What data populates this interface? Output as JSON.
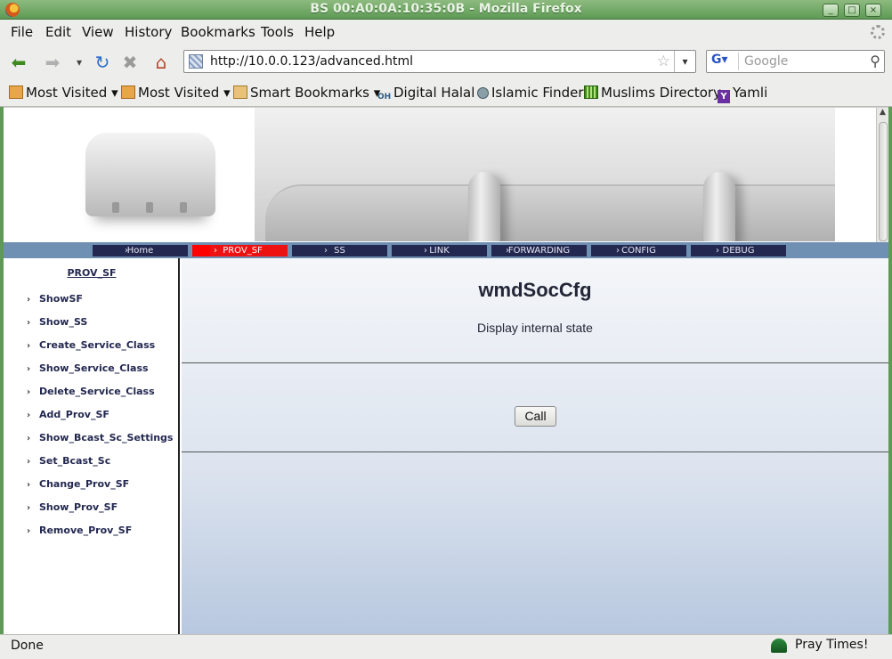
{
  "window": {
    "title": "BS 00:A0:0A:10:35:0B - Mozilla Firefox"
  },
  "menu": [
    "File",
    "Edit",
    "View",
    "History",
    "Bookmarks",
    "Tools",
    "Help"
  ],
  "nav": {
    "url": "http://10.0.0.123/advanced.html",
    "search_placeholder": "Google"
  },
  "bookmarks": [
    "Most Visited",
    "Most Visited",
    "Smart Bookmarks",
    "Digital Halal",
    "Islamic Finder",
    "Muslims Directory",
    "Yamli"
  ],
  "topnav": [
    "Home",
    "PROV_SF",
    "SS",
    "LINK",
    "FORWARDING",
    "CONFIG",
    "DEBUG"
  ],
  "sidebar": {
    "heading": "PROV_SF",
    "items": [
      "ShowSF",
      "Show_SS",
      "Create_Service_Class",
      "Show_Service_Class",
      "Delete_Service_Class",
      "Add_Prov_SF",
      "Show_Bcast_Sc_Settings",
      "Set_Bcast_Sc",
      "Change_Prov_SF",
      "Show_Prov_SF",
      "Remove_Prov_SF"
    ]
  },
  "main": {
    "title": "wmdSocCfg",
    "subtitle": "Display internal state",
    "call_label": "Call"
  },
  "status": {
    "text": "Done",
    "addon": "Pray Times!"
  },
  "colors": {
    "nav_bg": "#232850",
    "nav_active": "#ff0000",
    "strip": "#6f8fb3",
    "titlebar": "#6fa764"
  }
}
